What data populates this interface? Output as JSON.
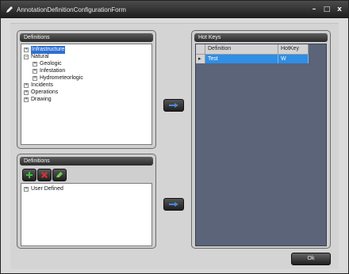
{
  "window": {
    "title": "AnnotationDefinitionConfigurationForm",
    "min_glyph": "–",
    "max_glyph": "□",
    "close_glyph": "x"
  },
  "definitions_panel": {
    "header": "Definitions",
    "tree": [
      {
        "label": "Infrastructure",
        "expander": "+",
        "selected": true
      },
      {
        "label": "Natural",
        "expander": "−",
        "selected": false
      },
      {
        "label": "Geologic",
        "expander": "+",
        "selected": false
      },
      {
        "label": "Infestation",
        "expander": "+",
        "selected": false
      },
      {
        "label": "Hydrometeorlogic",
        "expander": "+",
        "selected": false
      },
      {
        "label": "Incidents",
        "expander": "+",
        "selected": false
      },
      {
        "label": "Operations",
        "expander": "+",
        "selected": false
      },
      {
        "label": "Drawing",
        "expander": "+",
        "selected": false
      }
    ]
  },
  "user_definitions_panel": {
    "header": "Definitions",
    "tree": [
      {
        "label": "User Defined",
        "expander": "+"
      }
    ]
  },
  "hotkeys_panel": {
    "header": "Hot Keys",
    "columns": [
      "Definition",
      "HotKey"
    ],
    "rows": [
      {
        "indicator": "▸",
        "definition": "Test",
        "hotkey": "W"
      }
    ]
  },
  "buttons": {
    "ok_label": "Ok"
  },
  "colors": {
    "selection": "#2e6fd3",
    "grid_background": "#5b6478",
    "row_highlight": "#2f8ee6"
  }
}
